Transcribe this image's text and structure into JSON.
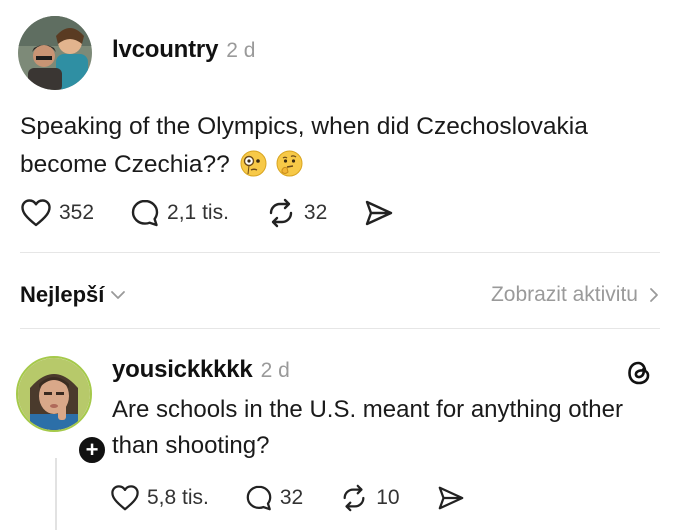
{
  "post": {
    "username": "lvcountry",
    "time": "2 d",
    "text": "Speaking of the Olympics, when did Czechoslovakia become Czechia??",
    "emojis": [
      "face-with-monocle-emoji",
      "thinking-face-emoji"
    ],
    "likes": "352",
    "comments": "2,1 tis.",
    "reposts": "32"
  },
  "sort": {
    "label": "Nejlepší",
    "activity_link": "Zobrazit aktivitu"
  },
  "reply": {
    "username": "yousickkkkk",
    "time": "2 d",
    "text": "Are schools in the U.S. meant for anything other than shooting?",
    "plus_badge": "+",
    "likes": "5,8 tis.",
    "comments": "32",
    "reposts": "10"
  },
  "colors": {
    "text": "#1a1a1a",
    "muted": "#9a9a9a",
    "divider": "#e6e6e6",
    "avatar_ring": "#a5c94a"
  }
}
